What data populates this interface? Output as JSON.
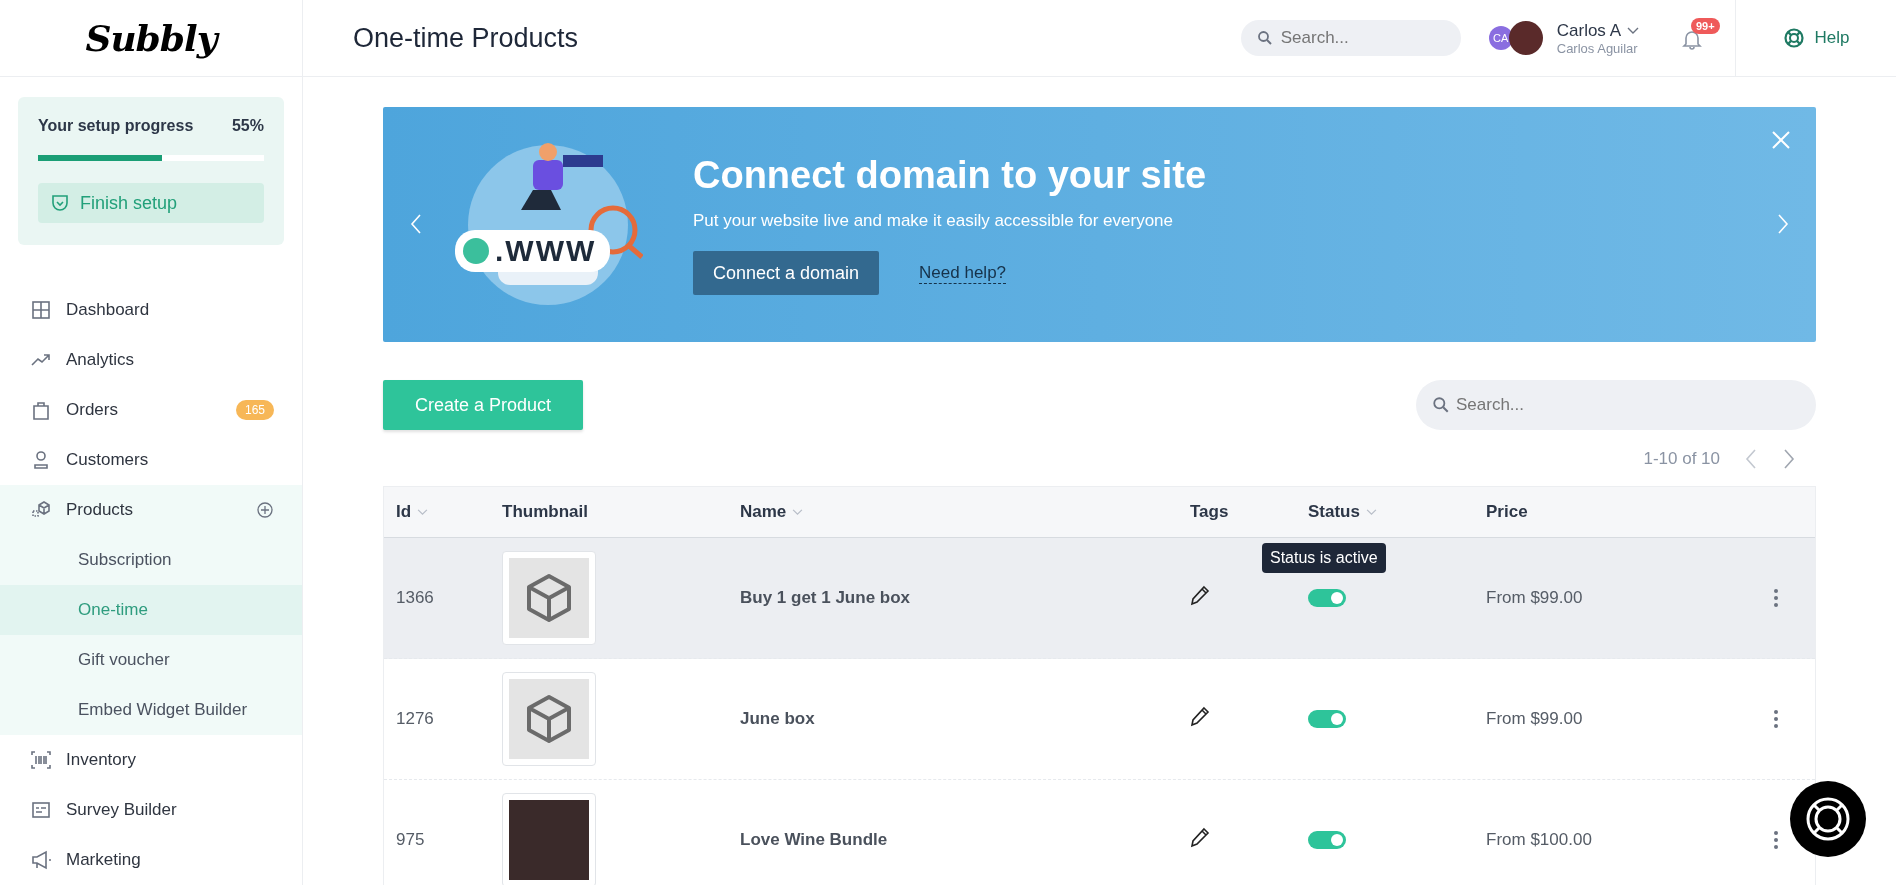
{
  "logo": {
    "text": "Subbly"
  },
  "header": {
    "title": "One-time Products",
    "search": {
      "placeholder": "Search..."
    },
    "user": {
      "initials": "CA",
      "name": "Carlos A",
      "full_name": "Carlos Aguilar"
    },
    "notifications": {
      "badge": "99+"
    },
    "help": {
      "label": "Help"
    }
  },
  "setup": {
    "title": "Your setup progress",
    "percent": "55%",
    "level": 0.55,
    "button": "Finish setup"
  },
  "sidebar": {
    "items": [
      {
        "label": "Dashboard",
        "selected": false
      },
      {
        "label": "Analytics",
        "selected": false
      },
      {
        "label": "Orders",
        "badge": "165",
        "selected": false
      },
      {
        "label": "Customers",
        "selected": false
      },
      {
        "label": "Products",
        "selected": false,
        "expanded": true,
        "children": [
          {
            "label": "Subscription",
            "selected": false
          },
          {
            "label": "One-time",
            "selected": true
          },
          {
            "label": "Gift voucher",
            "selected": false
          },
          {
            "label": "Embed Widget Builder",
            "selected": false
          }
        ]
      },
      {
        "label": "Inventory",
        "selected": false
      },
      {
        "label": "Survey Builder",
        "selected": false
      },
      {
        "label": "Marketing",
        "selected": false
      }
    ]
  },
  "banner": {
    "illustration_text": ".WWW",
    "title": "Connect domain to your site",
    "text": "Put your website live and make it easily accessible for everyone",
    "button": "Connect a domain",
    "link": "Need help?"
  },
  "toolbar": {
    "create_button": "Create a Product",
    "search": {
      "placeholder": "Search..."
    },
    "pagination": "1-10 of 10"
  },
  "table": {
    "columns": [
      {
        "label": "Id",
        "sortable": true
      },
      {
        "label": "Thumbnail",
        "sortable": false
      },
      {
        "label": "Name",
        "sortable": true
      },
      {
        "label": "Tags",
        "sortable": false
      },
      {
        "label": "Status",
        "sortable": true
      },
      {
        "label": "Price",
        "sortable": false
      }
    ],
    "rows": [
      {
        "id": "1366",
        "kind": "placeholder",
        "name": "Buy 1 get 1 June box",
        "active": true,
        "hovered": true,
        "tooltip": "Status is active",
        "price": "From $99.00"
      },
      {
        "id": "1276",
        "kind": "placeholder",
        "name": "June box",
        "active": true,
        "hovered": false,
        "price": "From $99.00"
      },
      {
        "id": "975",
        "kind": "photo",
        "name": "Love Wine Bundle",
        "active": true,
        "hovered": false,
        "price": "From $100.00"
      }
    ]
  }
}
